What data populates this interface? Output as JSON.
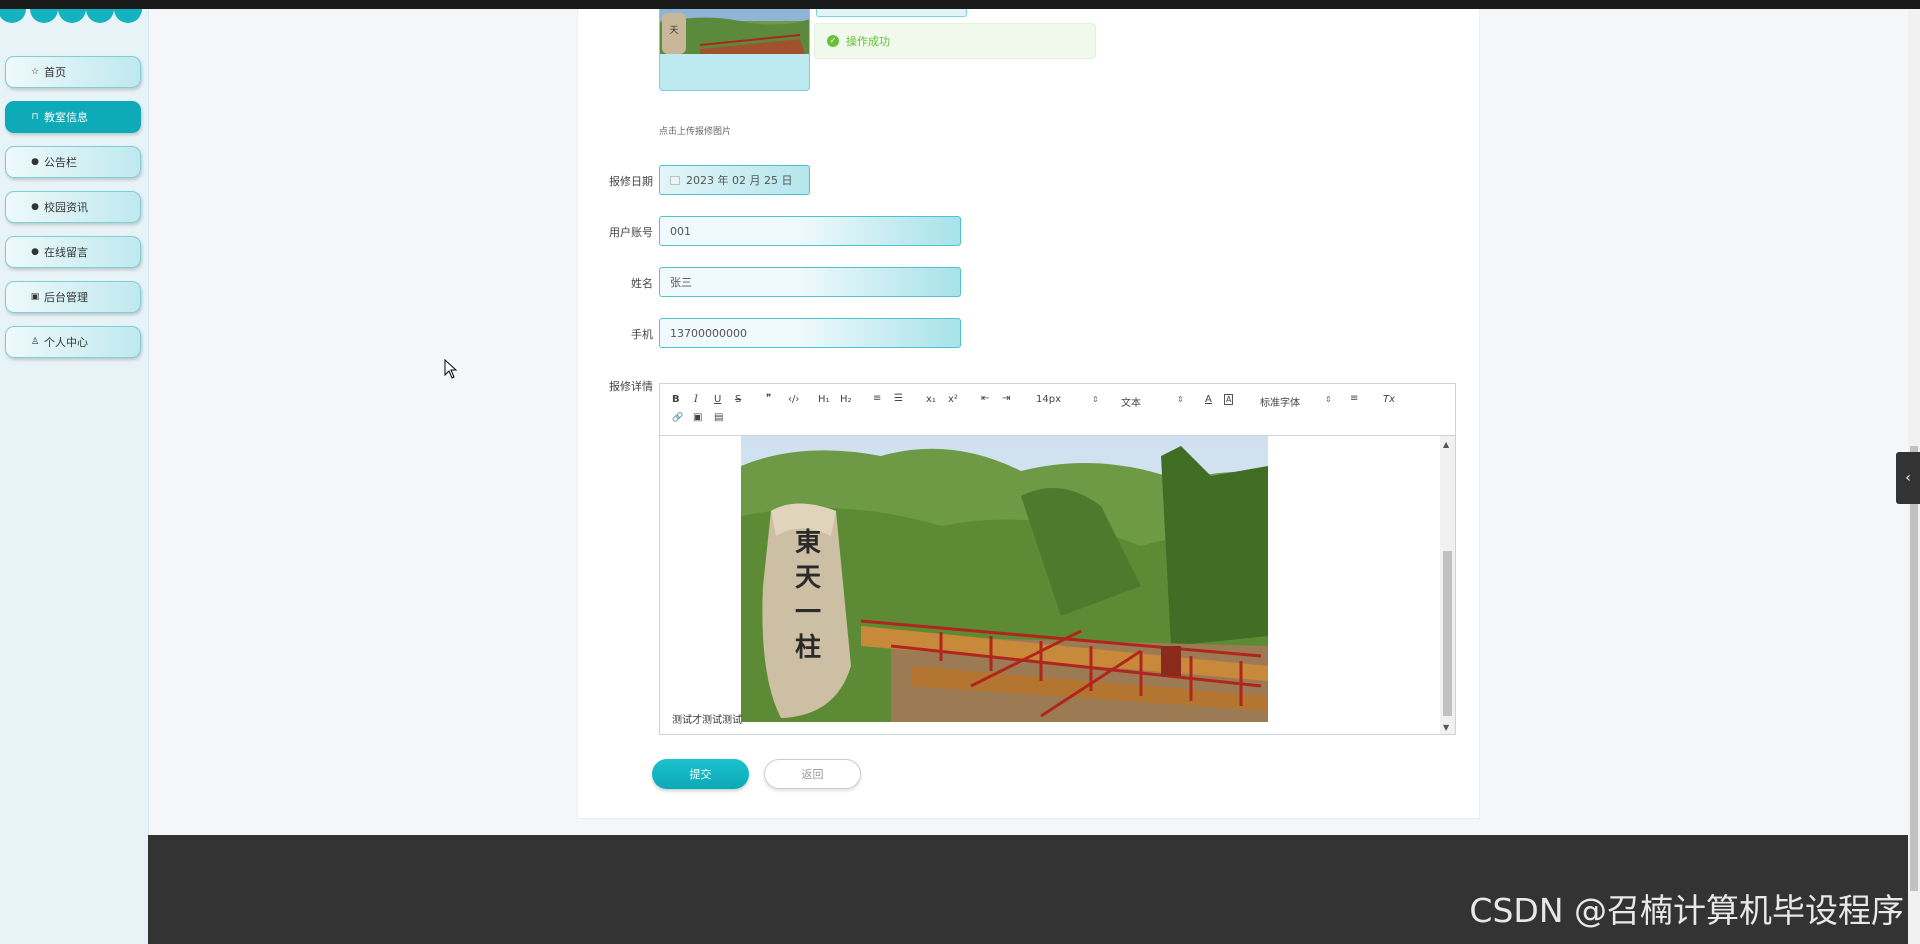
{
  "sidebar": {
    "items": [
      {
        "label": "首页",
        "icon": "star-icon",
        "active": false
      },
      {
        "label": "教室信息",
        "icon": "bag-icon",
        "active": true
      },
      {
        "label": "公告栏",
        "icon": "info-icon",
        "active": false
      },
      {
        "label": "校园资讯",
        "icon": "question-icon",
        "active": false
      },
      {
        "label": "在线留言",
        "icon": "info-icon",
        "active": false
      },
      {
        "label": "后台管理",
        "icon": "building-icon",
        "active": false
      },
      {
        "label": "个人中心",
        "icon": "user-icon",
        "active": false
      }
    ]
  },
  "toast": {
    "message": "操作成功",
    "type": "success"
  },
  "form": {
    "upload_note": "点击上传报修图片",
    "date_label": "报修日期",
    "date_value": "2023 年 02 月 25 日",
    "account_label": "用户账号",
    "account_value": "001",
    "name_label": "姓名",
    "name_value": "张三",
    "phone_label": "手机",
    "phone_value": "13700000000",
    "detail_label": "报修详情",
    "submit_label": "提交",
    "back_label": "返回"
  },
  "editor": {
    "toolbar": {
      "bold": "B",
      "italic": "I",
      "underline": "U",
      "strike": "S",
      "quote": "❞",
      "code": "‹/›",
      "h1": "H₁",
      "h2": "H₂",
      "ordered_list": "≡",
      "bullet_list": "☰",
      "subscript": "x₁",
      "superscript": "x²",
      "outdent": "⇤",
      "indent": "⇥",
      "size_value": "14px",
      "header_value": "文本",
      "font_value": "标准字体",
      "color": "A",
      "background": "A",
      "align": "≡",
      "clean": "Tx",
      "link": "🔗",
      "image": "▣",
      "video": "▤"
    },
    "content_text": "测试才测试测试"
  },
  "photo": {
    "stone_text": [
      "東",
      "天",
      "一",
      "柱"
    ]
  },
  "footer": {
    "watermark": "CSDN @召楠计算机毕设程序"
  },
  "colors": {
    "accent": "#0eaab7",
    "success": "#67c23a",
    "footer": "#333333"
  }
}
